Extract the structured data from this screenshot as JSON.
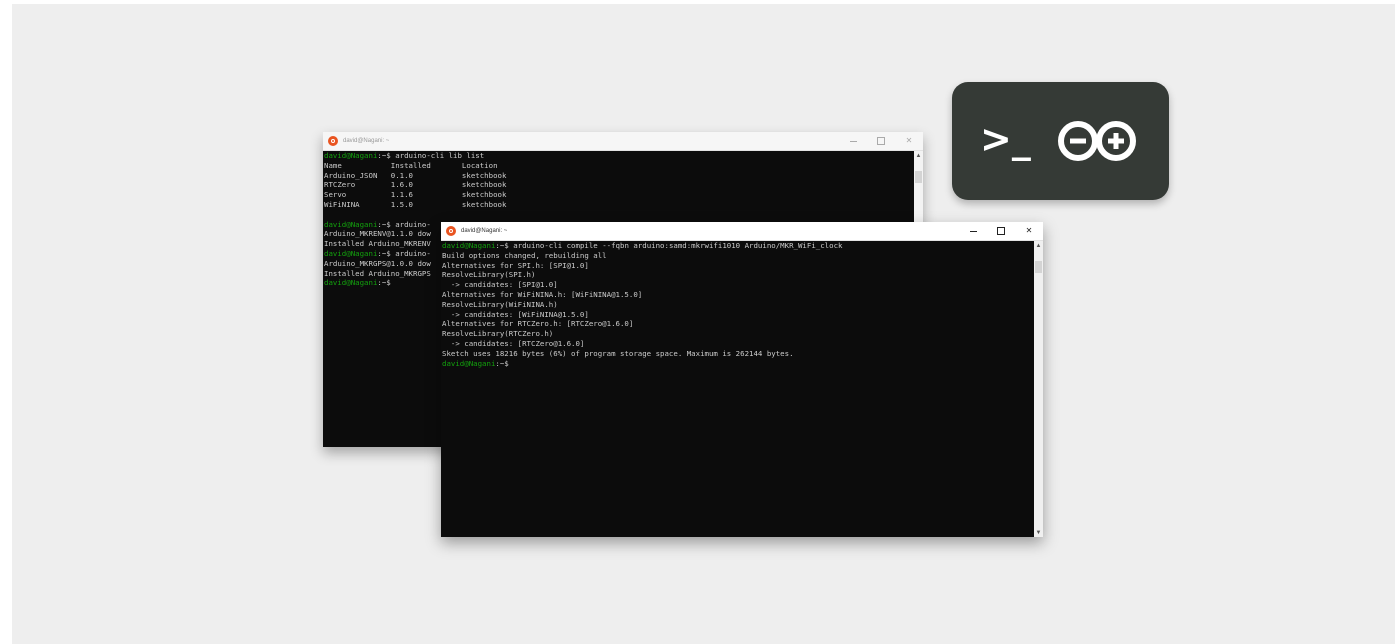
{
  "logo": {
    "prompt": ">_",
    "icon": "arduino-infinity-icon"
  },
  "colors": {
    "background": "#eeeeee",
    "terminal_bg": "#0c0c0c",
    "prompt_green": "#13a10e",
    "text": "#cccccc",
    "ubuntu_orange": "#e95420",
    "logo_bg": "#353a36"
  },
  "back_window": {
    "title": "david@Nagani: ~",
    "lines": [
      {
        "prompt": "david@Nagani",
        "rest": ":~$ arduino-cli lib list"
      },
      {
        "text": "Name           Installed       Location"
      },
      {
        "text": "Arduino_JSON   0.1.0           sketchbook"
      },
      {
        "text": "RTCZero        1.6.0           sketchbook"
      },
      {
        "text": "Servo          1.1.6           sketchbook"
      },
      {
        "text": "WiFiNINA       1.5.0           sketchbook"
      },
      {
        "text": ""
      },
      {
        "prompt": "david@Nagani",
        "rest": ":~$ arduino-"
      },
      {
        "text": "Arduino_MKRENV@1.1.0 dow"
      },
      {
        "text": "Installed Arduino_MKRENV"
      },
      {
        "prompt": "david@Nagani",
        "rest": ":~$ arduino-"
      },
      {
        "text": "Arduino_MKRGPS@1.0.0 dow"
      },
      {
        "text": "Installed Arduino_MKRGPS"
      },
      {
        "prompt": "david@Nagani",
        "rest": ":~$"
      }
    ]
  },
  "front_window": {
    "title": "david@Nagani: ~",
    "lines": [
      {
        "prompt": "david@Nagani",
        "rest": ":~$ arduino-cli compile --fqbn arduino:samd:mkrwifi1010 Arduino/MKR_WiFi_clock"
      },
      {
        "text": "Build options changed, rebuilding all"
      },
      {
        "text": "Alternatives for SPI.h: [SPI@1.0]"
      },
      {
        "text": "ResolveLibrary(SPI.h)"
      },
      {
        "text": "  -> candidates: [SPI@1.0]"
      },
      {
        "text": "Alternatives for WiFiNINA.h: [WiFiNINA@1.5.0]"
      },
      {
        "text": "ResolveLibrary(WiFiNINA.h)"
      },
      {
        "text": "  -> candidates: [WiFiNINA@1.5.0]"
      },
      {
        "text": "Alternatives for RTCZero.h: [RTCZero@1.6.0]"
      },
      {
        "text": "ResolveLibrary(RTCZero.h)"
      },
      {
        "text": "  -> candidates: [RTCZero@1.6.0]"
      },
      {
        "text": "Sketch uses 18216 bytes (6%) of program storage space. Maximum is 262144 bytes."
      },
      {
        "prompt": "david@Nagani",
        "rest": ":~$"
      }
    ]
  }
}
